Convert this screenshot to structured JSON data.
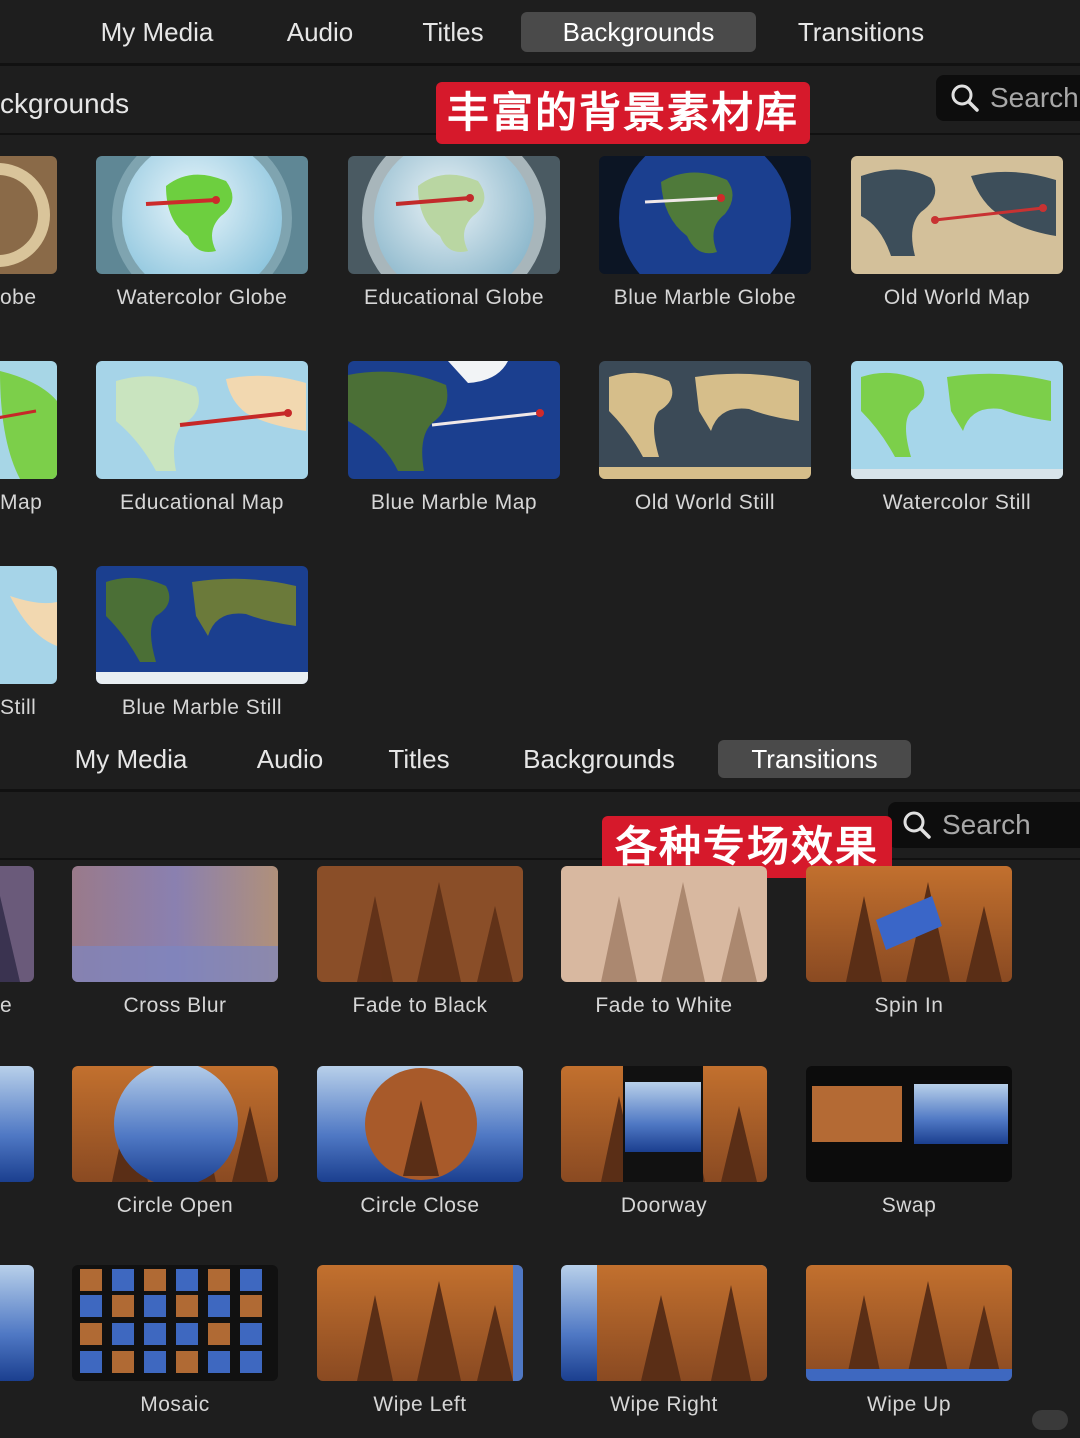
{
  "colors": {
    "accent_banner": "#d6192b",
    "active_tab": "#4a4a4a",
    "background": "#1e1e1e"
  },
  "backgrounds_panel": {
    "tabs": [
      "My Media",
      "Audio",
      "Titles",
      "Backgrounds",
      "Transitions"
    ],
    "active_tab": "Backgrounds",
    "section_title": "ckgrounds",
    "search_placeholder": "Search",
    "banner": "丰富的背景素材库",
    "items": [
      {
        "label": "obe"
      },
      {
        "label": "Watercolor Globe"
      },
      {
        "label": "Educational Globe"
      },
      {
        "label": "Blue Marble Globe"
      },
      {
        "label": "Old World Map"
      },
      {
        "label": "Map"
      },
      {
        "label": "Educational Map"
      },
      {
        "label": "Blue Marble Map"
      },
      {
        "label": "Old World Still"
      },
      {
        "label": "Watercolor Still"
      },
      {
        "label": "Still"
      },
      {
        "label": "Blue Marble Still"
      }
    ]
  },
  "transitions_panel": {
    "tabs": [
      "My Media",
      "Audio",
      "Titles",
      "Backgrounds",
      "Transitions"
    ],
    "active_tab": "Transitions",
    "search_placeholder": "Search",
    "banner": "各种专场效果",
    "items": [
      {
        "label": "e"
      },
      {
        "label": "Cross Blur"
      },
      {
        "label": "Fade to Black"
      },
      {
        "label": "Fade to White"
      },
      {
        "label": "Spin In"
      },
      {
        "label": ""
      },
      {
        "label": "Circle Open"
      },
      {
        "label": "Circle Close"
      },
      {
        "label": "Doorway"
      },
      {
        "label": "Swap"
      },
      {
        "label": ""
      },
      {
        "label": "Mosaic"
      },
      {
        "label": "Wipe Left"
      },
      {
        "label": "Wipe Right"
      },
      {
        "label": "Wipe Up"
      }
    ]
  }
}
